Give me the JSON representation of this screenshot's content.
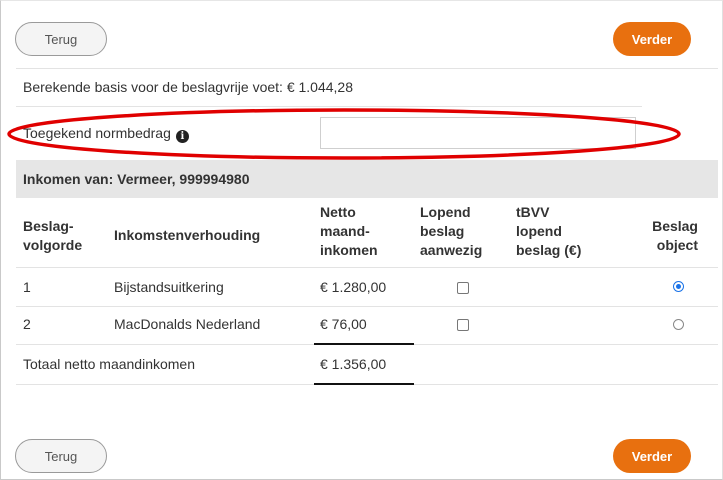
{
  "nav": {
    "back_label": "Terug",
    "next_label": "Verder"
  },
  "basis": {
    "text": "Berekende basis voor de beslagvrije voet: € 1.044,28"
  },
  "normbedrag": {
    "label": "Toegekend normbedrag",
    "info_icon": "info-icon",
    "value": ""
  },
  "income_section": {
    "title": "Inkomen van: Vermeer, 999994980"
  },
  "table": {
    "headers": {
      "order": [
        "Beslag-",
        "volgorde"
      ],
      "relation": "Inkomstenverhouding",
      "netto": [
        "Netto",
        "maand-",
        "inkomen"
      ],
      "lopend": [
        "Lopend",
        "beslag",
        "aanwezig"
      ],
      "tbvv": [
        "tBVV",
        "lopend",
        "beslag (€)"
      ],
      "object": [
        "Beslag",
        "object"
      ]
    },
    "rows": [
      {
        "order": "1",
        "relation": "Bijstandsuitkering",
        "netto": "€ 1.280,00",
        "lopend_checked": false,
        "tbvv": "",
        "object_selected": true
      },
      {
        "order": "2",
        "relation": "MacDonalds Nederland",
        "netto": "€ 76,00",
        "lopend_checked": false,
        "tbvv": "",
        "object_selected": false
      }
    ],
    "total_label": "Totaal netto maandinkomen",
    "total_value": "€ 1.356,00"
  },
  "colors": {
    "accent": "#e8700f",
    "annotation": "#e00000",
    "radio_selected": "#1a73e8"
  }
}
